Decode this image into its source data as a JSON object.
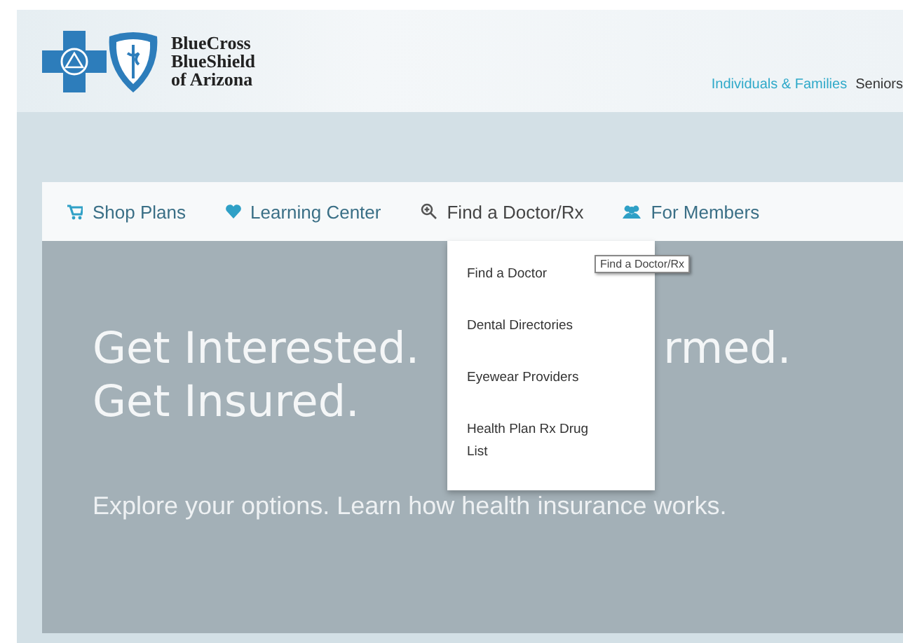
{
  "header": {
    "logo_text": [
      "BlueCross",
      "BlueShield",
      "of Arizona"
    ],
    "audience_links": [
      {
        "label": "Individuals & Families",
        "selected": true
      },
      {
        "label": "Seniors",
        "selected": false
      }
    ]
  },
  "nav": [
    {
      "label": "Shop Plans",
      "kind": "cart"
    },
    {
      "label": "Learning Center",
      "kind": "heart"
    },
    {
      "label": "Find a Doctor/Rx",
      "kind": "search"
    },
    {
      "label": "For Members",
      "kind": "members"
    }
  ],
  "dropdown": {
    "items": [
      "Find a Doctor",
      "Dental Directories",
      "Eyewear Providers",
      "Health Plan Rx Drug List"
    ]
  },
  "tooltip": "Find a Doctor/Rx",
  "hero": {
    "headline_left": "Get Interested.",
    "headline_right": "rmed.",
    "headline_line2": "Get Insured.",
    "text": "Explore your options. Learn how health insurance works."
  }
}
